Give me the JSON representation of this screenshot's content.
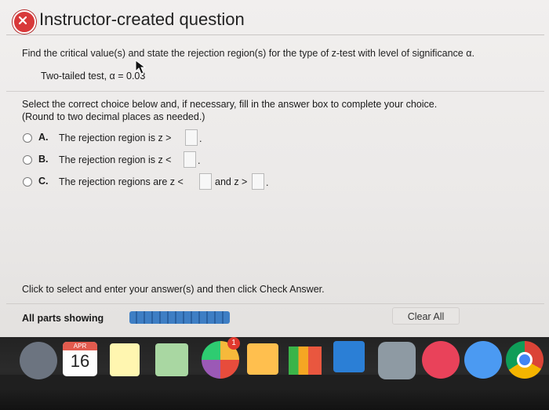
{
  "title": "Instructor-created question",
  "question": "Find the critical value(s) and state the rejection region(s) for the type of z-test with level of significance α.",
  "test_info": "Two-tailed test, α = 0.03",
  "instructions": {
    "line1": "Select the correct choice below and, if necessary, fill in the answer box to complete your choice.",
    "line2": "(Round to two decimal places as needed.)"
  },
  "options": [
    {
      "letter": "A.",
      "text": "The rejection region is z >"
    },
    {
      "letter": "B.",
      "text": "The rejection region is z <"
    },
    {
      "letter": "C.",
      "text": "The rejection regions are z <",
      "between": "and z >"
    }
  ],
  "answer_suffix": ".",
  "footer_message": "Click to select and enter your answer(s) and then click Check Answer.",
  "parts_label": "All parts showing",
  "clear_all_label": "Clear All",
  "dock": {
    "calendar_month": "APR",
    "calendar_day": "16",
    "photos_badge": "1"
  },
  "colors": {
    "error_icon": "#d8393a",
    "progress_bar": "#2f6db3",
    "dock_background": "#232323"
  },
  "icons": [
    "close-x-icon",
    "cursor-icon",
    "launchpad-icon",
    "calendar-icon",
    "notes-icon",
    "maps-icon",
    "photos-icon",
    "pages-icon",
    "numbers-icon",
    "keynote-icon",
    "system-preferences-icon",
    "itunes-icon",
    "messages-icon",
    "chrome-icon"
  ]
}
